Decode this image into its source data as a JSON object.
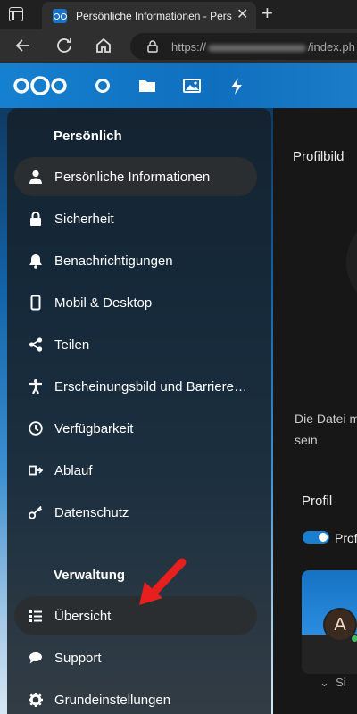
{
  "browser": {
    "tab_title": "Persönliche Informationen - Persönlich",
    "tab_close": "✕",
    "new_tab": "+",
    "url_prefix": "https://",
    "url_suffix": "/index.ph"
  },
  "header": {
    "apps": [
      "dashboard",
      "files",
      "photos",
      "activity"
    ]
  },
  "sidebar": {
    "section_personal": "Persönlich",
    "personal_items": [
      {
        "label": "Persönliche Informationen",
        "icon": "person-icon",
        "active": true
      },
      {
        "label": "Sicherheit",
        "icon": "lock-icon",
        "active": false
      },
      {
        "label": "Benachrichtigungen",
        "icon": "bell-icon",
        "active": false
      },
      {
        "label": "Mobil & Desktop",
        "icon": "phone-icon",
        "active": false
      },
      {
        "label": "Teilen",
        "icon": "share-icon",
        "active": false
      },
      {
        "label": "Erscheinungsbild und Barrierefreiheit",
        "icon": "accessibility-icon",
        "active": false
      },
      {
        "label": "Verfügbarkeit",
        "icon": "clock-icon",
        "active": false
      },
      {
        "label": "Ablauf",
        "icon": "flow-icon",
        "active": false
      },
      {
        "label": "Datenschutz",
        "icon": "key-icon",
        "active": false
      }
    ],
    "section_admin": "Verwaltung",
    "admin_items": [
      {
        "label": "Übersicht",
        "icon": "list-icon",
        "active": true
      },
      {
        "label": "Support",
        "icon": "chat-icon",
        "active": false
      },
      {
        "label": "Grundeinstellungen",
        "icon": "gear-icon",
        "active": false
      }
    ]
  },
  "main": {
    "profile_picture_heading": "Profilbild",
    "note": "Die Datei m sein",
    "profile_heading": "Profil",
    "toggle_label": "Prof",
    "avatar_letter": "A",
    "expander_label": "Si"
  },
  "colors": {
    "accent": "#1a7fce",
    "header_blue": "#1680d0",
    "annotation_arrow": "#e8201d"
  }
}
